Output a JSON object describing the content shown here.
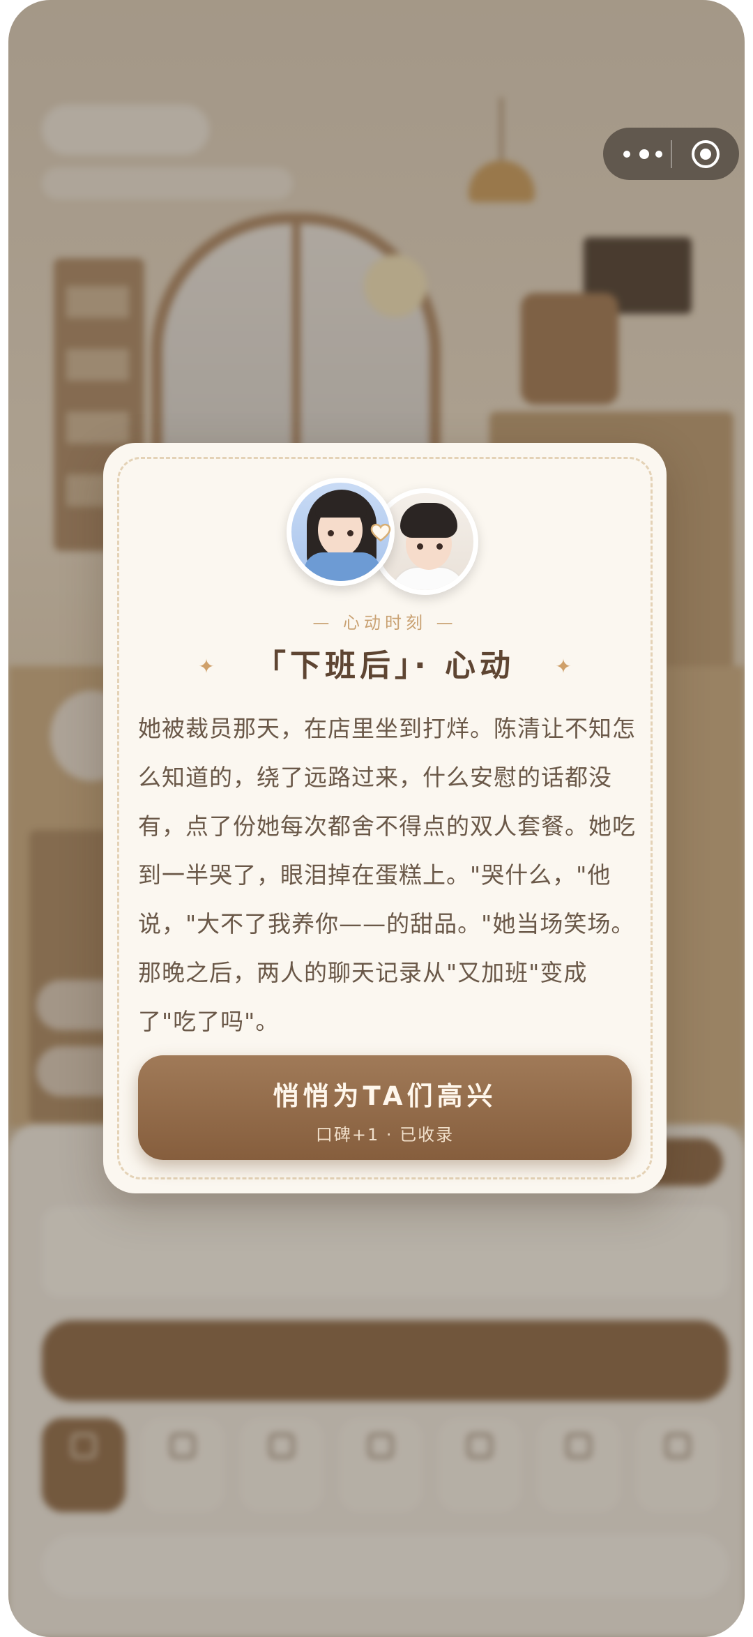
{
  "modal": {
    "kicker": "— 心动时刻 —",
    "title": "「下班后」· 心动",
    "story": "她被裁员那天，在店里坐到打烊。陈清让不知怎么知道的，绕了远路过来，什么安慰的话都没有，点了份她每次都舍不得点的双人套餐。她吃到一半哭了，眼泪掉在蛋糕上。\"哭什么，\"他说，\"大不了我养你——的甜品。\"她当场笑场。那晚之后，两人的聊天记录从\"又加班\"变成了\"吃了吗\"。",
    "cta_label": "悄悄为TA们高兴",
    "cta_sub": "口碑+1 · 已收录",
    "icons": {
      "heart": "heart-outline-icon",
      "sparkle": "sparkle-icon"
    }
  },
  "capsule": {
    "more": "more-icon",
    "close": "close-target-icon"
  },
  "colors": {
    "accent": "#8a6543",
    "gold": "#cfa06a",
    "card": "#fbf7f0",
    "text": "#6a5848"
  }
}
